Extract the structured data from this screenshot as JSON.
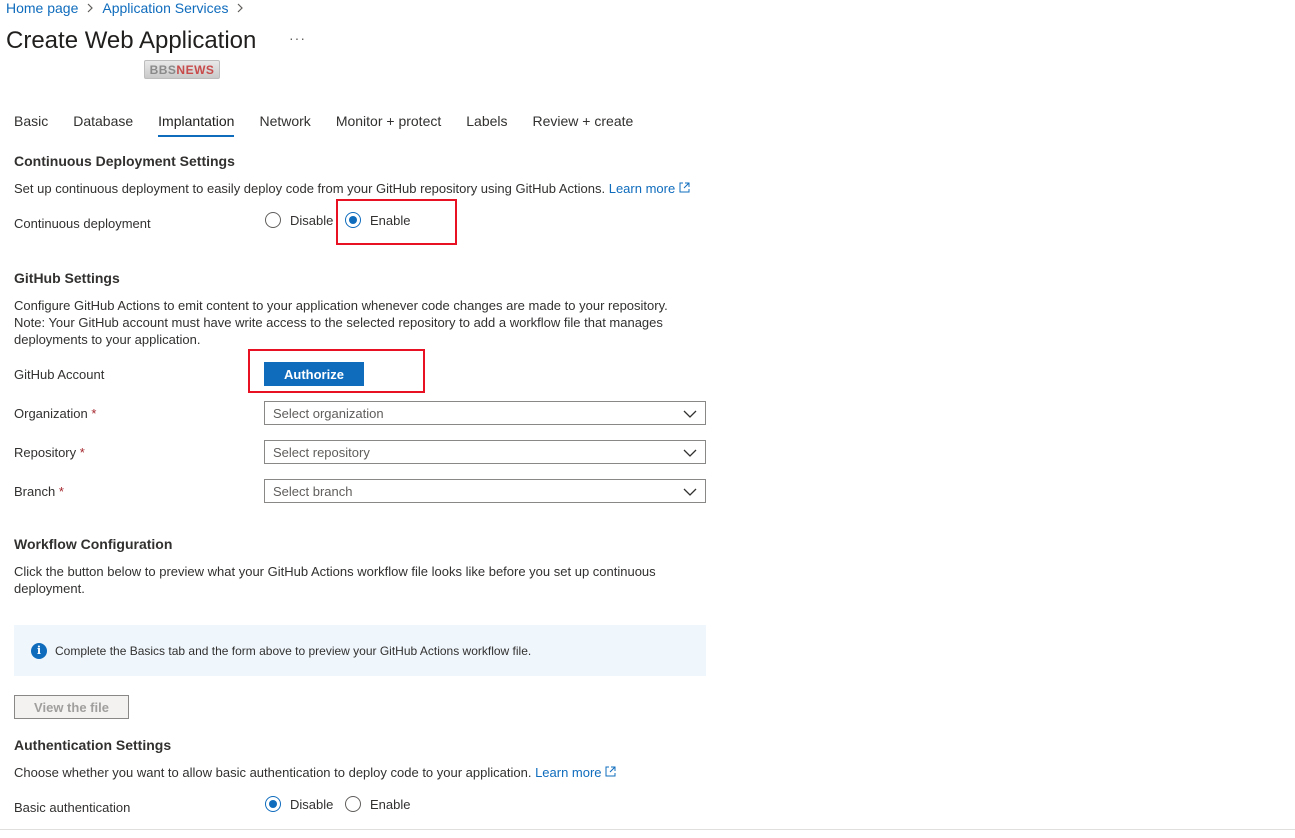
{
  "breadcrumb": {
    "items": [
      "Home page",
      "Application Services"
    ],
    "separator": ">"
  },
  "page": {
    "title": "Create Web Application",
    "more": "···",
    "watermark": "BBSNEWS"
  },
  "tabs": [
    {
      "label": "Basic",
      "active": false
    },
    {
      "label": "Database",
      "active": false
    },
    {
      "label": "Implantation",
      "active": true
    },
    {
      "label": "Network",
      "active": false
    },
    {
      "label": "Monitor + protect",
      "active": false
    },
    {
      "label": "Labels",
      "active": false
    },
    {
      "label": "Review + create",
      "active": false
    }
  ],
  "cd": {
    "title": "Continuous Deployment Settings",
    "desc": "Set up continuous deployment to easily deploy code from your GitHub repository using GitHub Actions.",
    "learn_more": "Learn more",
    "field_label": "Continuous deployment",
    "options": {
      "disable": "Disable",
      "enable": "Enable"
    },
    "selected": "enable"
  },
  "github": {
    "title": "GitHub Settings",
    "desc_line1": "Configure GitHub Actions to emit content to your application whenever code changes are made to your repository.",
    "desc_line2": "Note: Your GitHub account must have write access to the selected repository to add a workflow file that manages",
    "desc_line3": "deployments to your application.",
    "account_label": "GitHub Account",
    "authorize": "Authorize",
    "organization_label": "Organization",
    "organization_placeholder": "Select organization",
    "repository_label": "Repository",
    "repository_placeholder": "Select repository",
    "branch_label": "Branch",
    "branch_placeholder": "Select branch",
    "required_mark": "*"
  },
  "workflow": {
    "title": "Workflow Configuration",
    "desc_line1": "Click the button below to preview what your GitHub Actions workflow file looks like before you set up continuous",
    "desc_line2": "deployment.",
    "info": "Complete the Basics tab and the form above to preview your GitHub Actions workflow file.",
    "view_button": "View the file"
  },
  "auth": {
    "title": "Authentication Settings",
    "desc": "Choose whether you want to allow basic authentication to deploy code to your application.",
    "learn_more": "Learn more",
    "field_label": "Basic authentication",
    "options": {
      "disable": "Disable",
      "enable": "Enable"
    },
    "selected": "disable"
  },
  "colors": {
    "accent": "#0f6cbd",
    "highlight_box": "#e81123",
    "required": "#a4262c",
    "info_bg": "#eff6fc"
  }
}
